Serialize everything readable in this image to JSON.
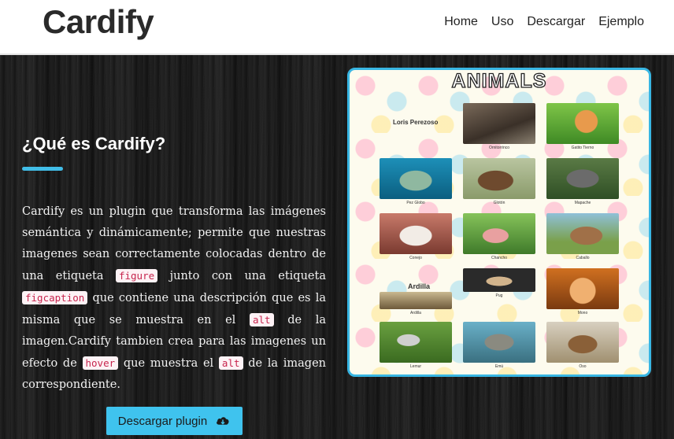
{
  "header": {
    "logo": "Cardify",
    "nav": [
      "Home",
      "Uso",
      "Descargar",
      "Ejemplo"
    ]
  },
  "main": {
    "title": "¿Qué es Cardify?",
    "desc": {
      "p1": "Cardify es un plugin que transforma las imágenes semántica y dinámicamente; permite que nuestras imagenes sean correctamente colocadas dentro de una etiqueta ",
      "c1": "figure",
      "p2": " junto con una etiqueta ",
      "c2": "figcaption",
      "p3": " que contiene una descripción que es la misma que se muestra en el ",
      "c3": "alt",
      "p4": " de la imagen.Cardify tambien crea para las imagenes un efecto de ",
      "c4": "hover",
      "p5": " que muestra el ",
      "c5": "alt",
      "p6": " de la imagen correspondiente."
    },
    "download_button": "Descargar plugin"
  },
  "poster": {
    "title": "ANIMALS",
    "name_label": "Loris Perezoso",
    "ardilla_label": "Ardilla",
    "captions": [
      "Ornitorrinco",
      "Gatito Tierno",
      "Pez Globo",
      "Glotón",
      "Mapache",
      "Conejo",
      "Chancho",
      "Caballo",
      "Ardilla",
      "Pug",
      "Mono",
      "Lemur",
      "Emú",
      "Oso"
    ]
  },
  "colors": {
    "accent": "#41bde7",
    "code_text": "#c7254e"
  }
}
